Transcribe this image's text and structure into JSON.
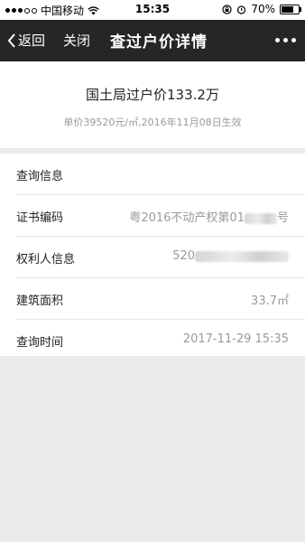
{
  "status_bar": {
    "carrier": "中国移动",
    "time": "15:35",
    "battery_percent": "70%",
    "battery_level": 0.7
  },
  "nav": {
    "back_label": "返回",
    "close_label": "关闭",
    "title": "查过户价详情"
  },
  "summary": {
    "headline": "国土局过户价133.2万",
    "sub": "单价39520元/㎡,2016年11月08日生效"
  },
  "info": {
    "section_title": "查询信息",
    "rows": [
      {
        "label": "证书编码",
        "value_prefix": "粤2016不动产权第01",
        "value_suffix": "号"
      },
      {
        "label": "权利人信息",
        "value_prefix": "520",
        "value_suffix": ""
      },
      {
        "label": "建筑面积",
        "value": "33.7㎡"
      },
      {
        "label": "查询时间",
        "value": "2017-11-29 15:35"
      }
    ]
  }
}
